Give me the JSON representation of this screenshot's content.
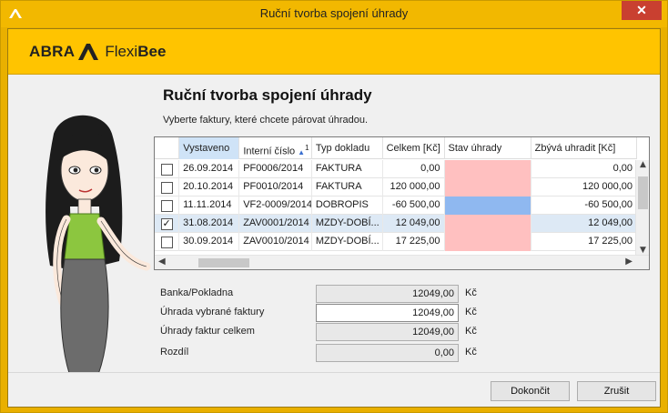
{
  "window": {
    "title": "Ruční tvorba spojení úhrady",
    "close_glyph": "✕"
  },
  "logo": {
    "abra": "ABRA",
    "flexi": "Flexi",
    "bee": "Bee"
  },
  "heading": "Ruční tvorba spojení úhrady",
  "subtitle": "Vyberte faktury, které chcete párovat úhradou.",
  "grid": {
    "columns": [
      "Vystaveno",
      "Interní číslo",
      "Typ dokladu",
      "Celkem [Kč]",
      "Stav úhrady",
      "Zbývá uhradit [Kč]"
    ],
    "sort_index": "1",
    "rows": [
      {
        "checked": false,
        "date": "26.09.2014",
        "number": "PF0006/2014",
        "type": "FAKTURA",
        "total": "0,00",
        "state": "pink",
        "remaining": "0,00"
      },
      {
        "checked": false,
        "date": "20.10.2014",
        "number": "PF0010/2014",
        "type": "FAKTURA",
        "total": "120 000,00",
        "state": "pink",
        "remaining": "120 000,00"
      },
      {
        "checked": false,
        "date": "11.11.2014",
        "number": "VF2-0009/2014",
        "type": "DOBROPIS",
        "total": "-60 500,00",
        "state": "blue",
        "remaining": "-60 500,00"
      },
      {
        "checked": true,
        "date": "31.08.2014",
        "number": "ZAV0001/2014",
        "type": "MZDY-DOBÍ...",
        "total": "12 049,00",
        "state": "pink",
        "remaining": "12 049,00"
      },
      {
        "checked": false,
        "date": "30.09.2014",
        "number": "ZAV0010/2014",
        "type": "MZDY-DOBÍ...",
        "total": "17 225,00",
        "state": "pink",
        "remaining": "17 225,00"
      }
    ]
  },
  "form": {
    "bank_label": "Banka/Pokladna",
    "bank_value": "12049,00",
    "payment_label": "Úhrada vybrané faktury",
    "payment_value": "12049,00",
    "total_label": "Úhrady faktur celkem",
    "total_value": "12049,00",
    "diff_label": "Rozdíl",
    "diff_value": "0,00",
    "currency": "Kč"
  },
  "buttons": {
    "finish": "Dokončit",
    "cancel": "Zrušit"
  },
  "colors": {
    "accent": "#ffc400",
    "state_pink": "#ffc0c0",
    "state_blue": "#8fb8f0"
  }
}
